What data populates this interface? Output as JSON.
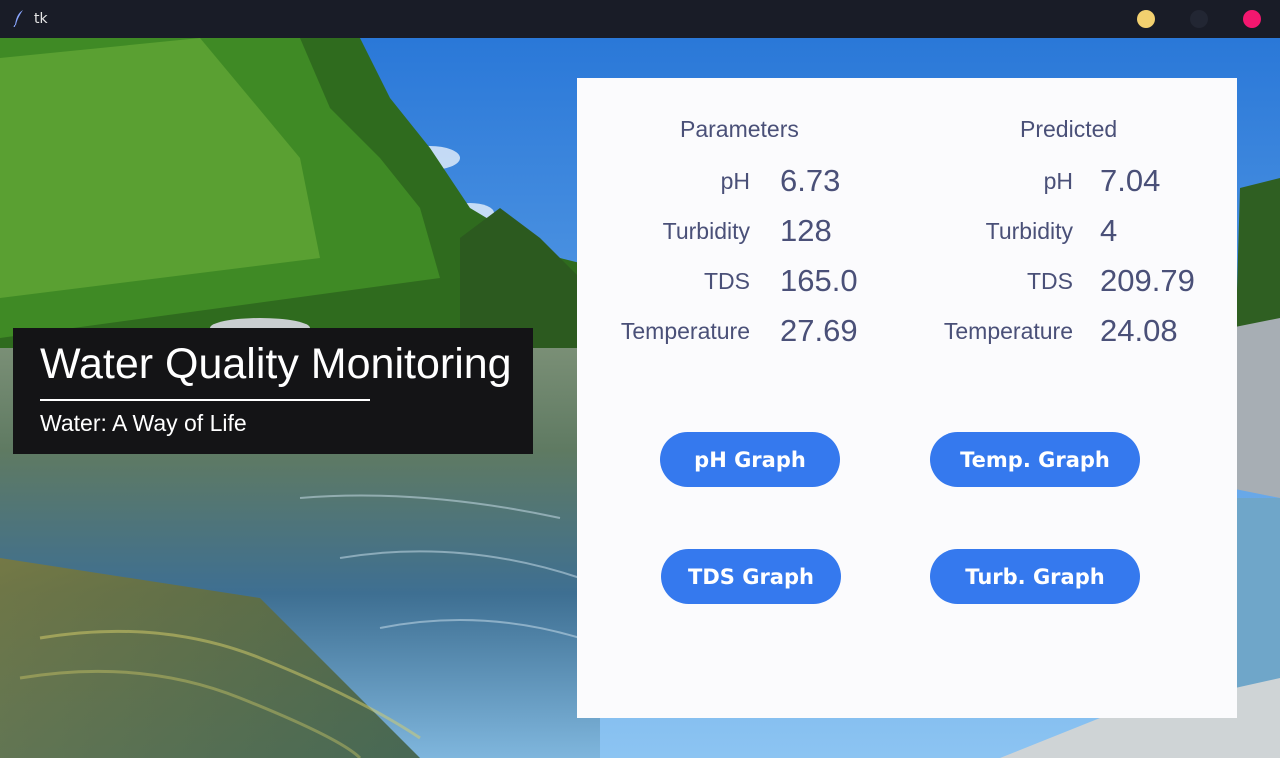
{
  "window": {
    "title": "tk",
    "icon": "feather-icon",
    "controls": [
      "minimize-button",
      "maximize-button",
      "close-button"
    ]
  },
  "banner": {
    "title": "Water Quality Monitoring",
    "subtitle": "Water: A Way of Life"
  },
  "parameters": {
    "heading": "Parameters",
    "rows": [
      {
        "label": "pH",
        "value": "6.73"
      },
      {
        "label": "Turbidity",
        "value": "128"
      },
      {
        "label": "TDS",
        "value": "165.0"
      },
      {
        "label": "Temperature",
        "value": "27.69"
      }
    ]
  },
  "predicted": {
    "heading": "Predicted",
    "rows": [
      {
        "label": "pH",
        "value": "7.04"
      },
      {
        "label": "Turbidity",
        "value": "4"
      },
      {
        "label": "TDS",
        "value": "209.79"
      },
      {
        "label": "Temperature",
        "value": "24.08"
      }
    ]
  },
  "buttons": {
    "ph_graph": "pH Graph",
    "temp_graph": "Temp. Graph",
    "tds_graph": "TDS Graph",
    "turb_graph": "Turb. Graph"
  },
  "colors": {
    "titlebar": "#191c27",
    "panel": "#fbfbfd",
    "text": "#4a5078",
    "button": "#3579ee",
    "minimize": "#f2d06f",
    "close": "#f3176f"
  }
}
